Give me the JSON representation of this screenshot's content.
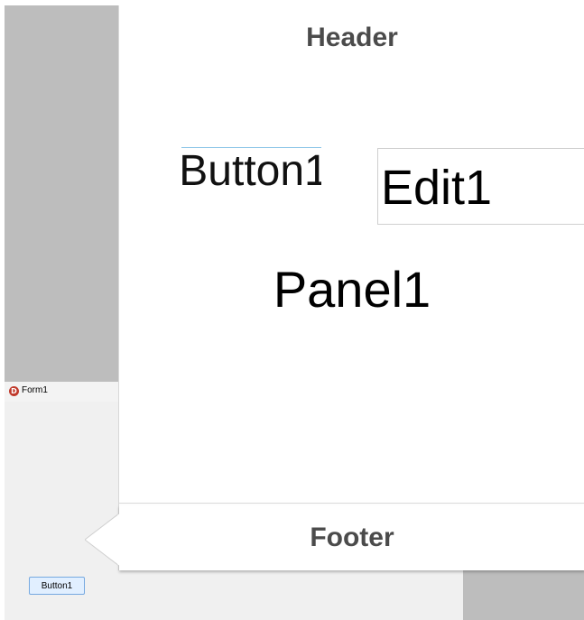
{
  "form": {
    "title": "Form1",
    "icon": "delphi-app-icon",
    "button_label": "Button1"
  },
  "panel": {
    "header": "Header",
    "button_label": "Button1",
    "edit_text": "Edit1",
    "caption": "Panel1",
    "footer": "Footer"
  },
  "colors": {
    "backdrop_gray": "#bdbdbd",
    "form_bg": "#f0f0f0",
    "button_blue": "#e1efff",
    "button_border": "#76a9e0",
    "header_text": "#4b4b4b",
    "icon_red": "#c0392b"
  }
}
